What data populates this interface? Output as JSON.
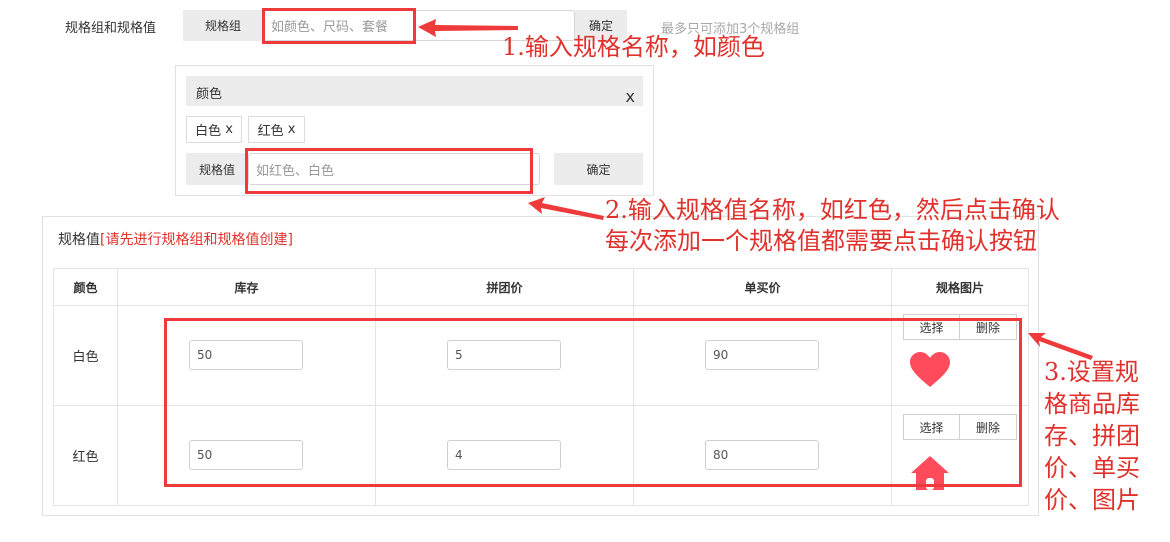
{
  "spec_form": {
    "main_label": "规格组和规格值",
    "group_tag": "规格组",
    "group_placeholder": "如颜色、尺码、套餐",
    "group_confirm": "确定",
    "group_limit_hint": "最多只可添加3个规格组"
  },
  "group_panel": {
    "name": "颜色",
    "close": "x",
    "values": [
      {
        "label": "白色",
        "remove": "x"
      },
      {
        "label": "红色",
        "remove": "x"
      }
    ],
    "value_tag": "规格值",
    "value_placeholder": "如红色、白色",
    "value_confirm": "确定"
  },
  "sku_section": {
    "title": "规格值",
    "title_note": "[请先进行规格组和规格值创建]",
    "headers": [
      "颜色",
      "库存",
      "拼团价",
      "单买价",
      "规格图片"
    ],
    "rows": [
      {
        "color": "白色",
        "stock": "50",
        "group_price": "5",
        "single_price": "90",
        "select": "选择",
        "delete": "删除",
        "image_icon": "heart-icon"
      },
      {
        "color": "红色",
        "stock": "50",
        "group_price": "4",
        "single_price": "80",
        "select": "选择",
        "delete": "删除",
        "image_icon": "home-icon"
      }
    ],
    "icon_color": "#ff4b5c"
  },
  "annotations": {
    "step1": "1.输入规格名称，如颜色",
    "step2_line1": "2.输入规格值名称，如红色，然后点击确认",
    "step2_line2": "每次添加一个规格值都需要点击确认按钮",
    "step3_lines": [
      "3.设置规",
      "格商品库",
      "存、拼团",
      "价、单买",
      "价、图片"
    ],
    "accent": "#ee3a3a"
  }
}
